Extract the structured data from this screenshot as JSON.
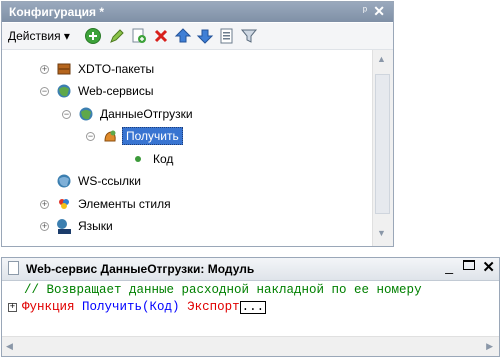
{
  "config_panel": {
    "title": "Конфигурация *",
    "pin_glyph": "ᵖ",
    "close_glyph": "✕",
    "toolbar": {
      "actions_label": "Действия ▾",
      "icons": [
        "add-icon",
        "edit-icon",
        "copy-icon",
        "delete-icon",
        "move-up-icon",
        "move-down-icon",
        "list-icon",
        "filter-icon"
      ]
    },
    "tree": [
      {
        "label": "XDTO-пакеты",
        "expander": "+",
        "icon": "xdto-package-icon"
      },
      {
        "label": "Web-сервисы",
        "expander": "−",
        "icon": "web-service-icon"
      },
      {
        "label": "ДанныеОтгрузки",
        "expander": "−",
        "icon": "web-service-icon"
      },
      {
        "label": "Получить",
        "expander": "−",
        "icon": "operation-icon",
        "selected": true
      },
      {
        "label": "Код",
        "expander": "",
        "icon": "bullet-icon"
      },
      {
        "label": "WS-ссылки",
        "expander": "",
        "icon": "ws-reference-icon"
      },
      {
        "label": "Элементы стиля",
        "expander": "+",
        "icon": "style-item-icon"
      },
      {
        "label": "Языки",
        "expander": "+",
        "icon": "language-icon"
      }
    ]
  },
  "module_panel": {
    "title": "Web-сервис ДанныеОтгрузки: Модуль",
    "min_glyph": "_",
    "close_glyph": "✕",
    "code": {
      "comment": "// Возвращает данные расходной накладной по ее номеру",
      "fold_glyph": "+",
      "kw_function": "Функция",
      "fn_name": "Получить",
      "params": "(Код)",
      "kw_export": "Экспорт",
      "ellipsis": "..."
    }
  },
  "colors": {
    "selection": "#3874d1",
    "comment": "#008000",
    "keyword": "#e00000",
    "identifier": "#0000ff"
  }
}
